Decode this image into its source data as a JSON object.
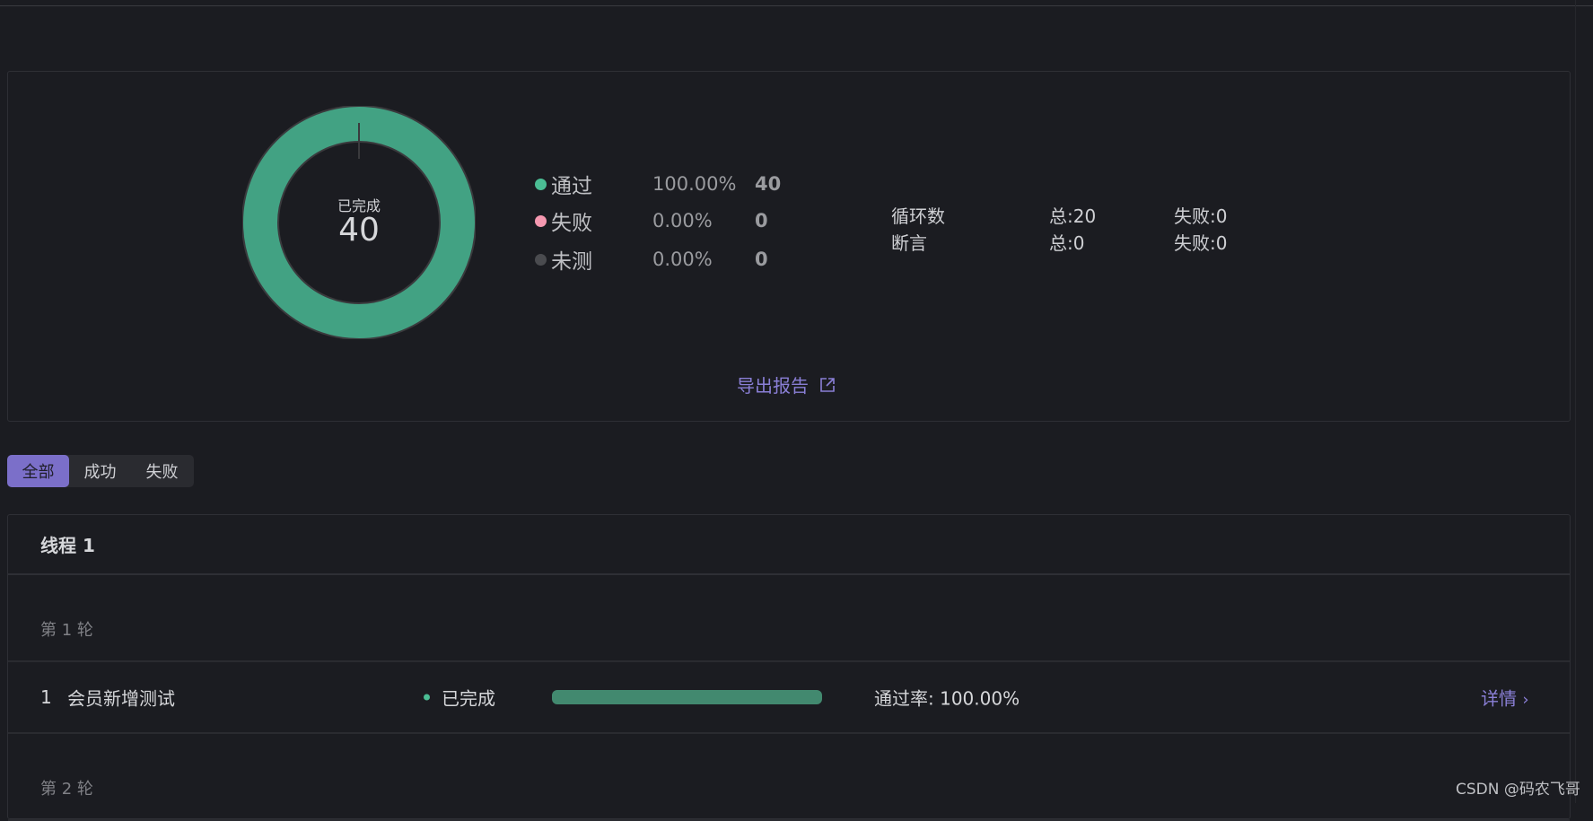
{
  "summary": {
    "donut": {
      "center_label": "已完成",
      "center_value": "40",
      "pass_fraction": 1.0,
      "color": "#42a283"
    },
    "legend": [
      {
        "label": "通过",
        "percent": "100.00%",
        "count": "40",
        "color": "#4bbd94"
      },
      {
        "label": "失败",
        "percent": "0.00%",
        "count": "0",
        "color": "#f598b0"
      },
      {
        "label": "未测",
        "percent": "0.00%",
        "count": "0",
        "color": "#4a4b4f"
      }
    ],
    "stats": [
      {
        "label": "循环数",
        "total": "总:20",
        "failed": "失败:0"
      },
      {
        "label": "断言",
        "total": "总:0",
        "failed": "失败:0"
      }
    ],
    "export_label": "导出报告"
  },
  "tabs": [
    "全部",
    "成功",
    "失败"
  ],
  "thread": {
    "title": "线程 1",
    "rounds": [
      {
        "label": "第 1 轮",
        "items": [
          {
            "index": "1",
            "name": "会员新增测试",
            "status": "已完成",
            "progress": 1.0,
            "pass_rate": "通过率: 100.00%",
            "detail_label": "详情"
          }
        ]
      },
      {
        "label": "第 2 轮",
        "items": []
      }
    ]
  },
  "watermark": "CSDN @码农飞哥"
}
